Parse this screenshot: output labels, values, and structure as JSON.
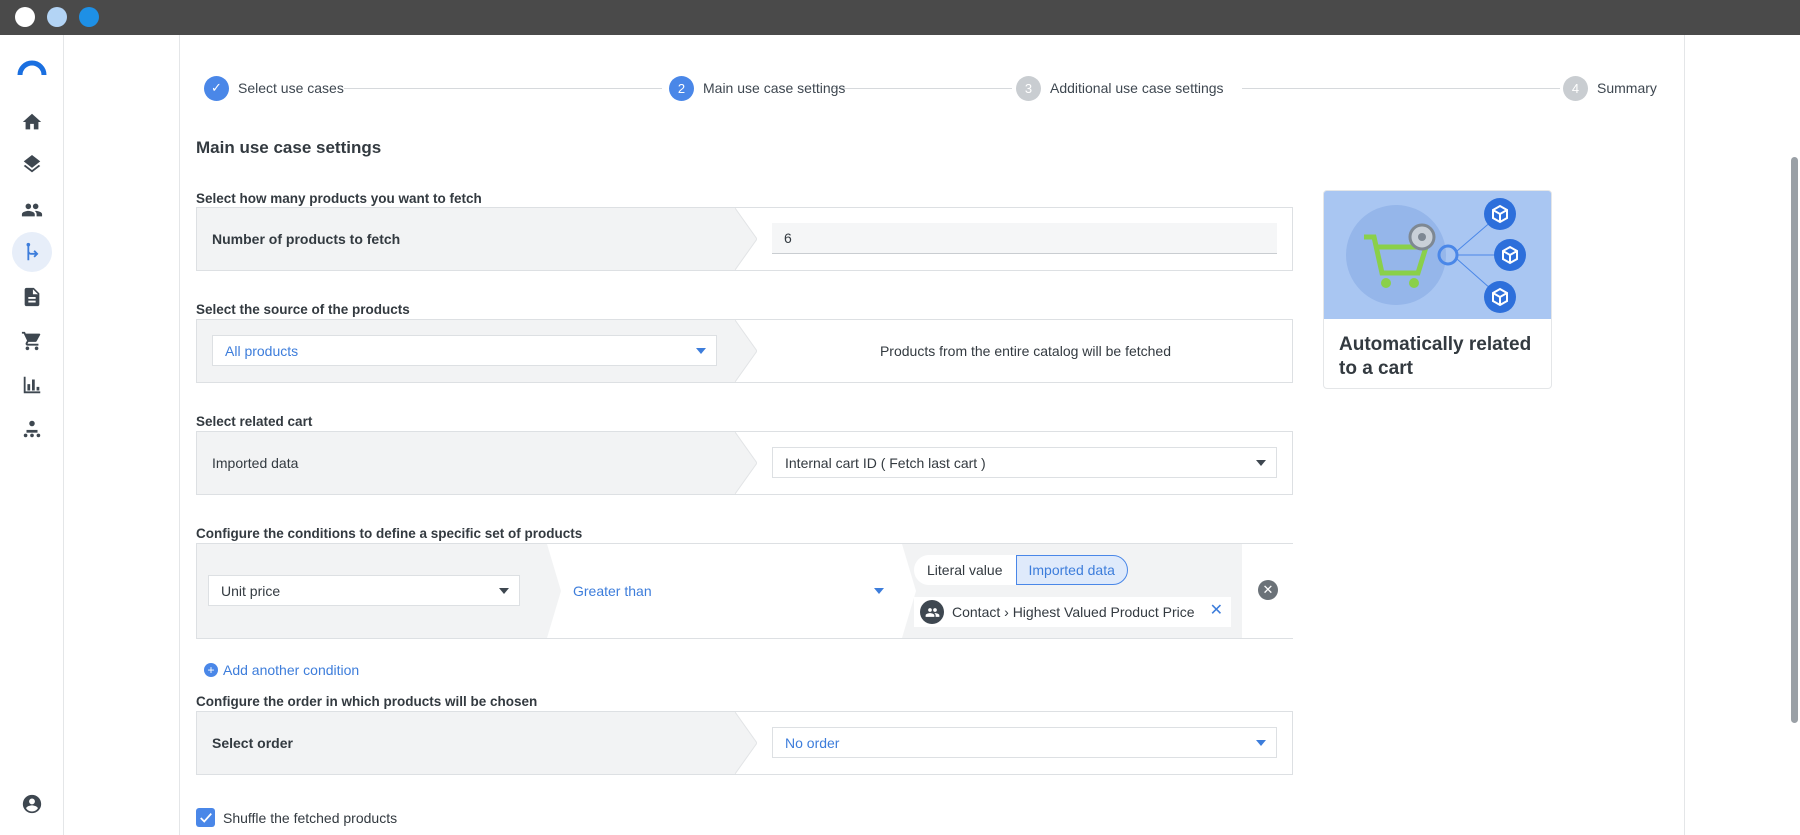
{
  "window": {
    "dots": [
      "#ffffff",
      "#b3d4f5",
      "#1e90e6"
    ]
  },
  "sidebar": {
    "logo": "brand-logo",
    "items": [
      {
        "icon": "home-icon"
      },
      {
        "icon": "layers-icon"
      },
      {
        "icon": "people-icon"
      },
      {
        "icon": "flow-icon",
        "active": true
      },
      {
        "icon": "document-icon"
      },
      {
        "icon": "cart-icon"
      },
      {
        "icon": "bar-chart-icon"
      },
      {
        "icon": "org-icon"
      }
    ],
    "bottom_icon": "account-icon"
  },
  "stepper": {
    "steps": [
      {
        "number": "✓",
        "label": "Select use cases",
        "state": "done"
      },
      {
        "number": "2",
        "label": "Main use case settings",
        "state": "current"
      },
      {
        "number": "3",
        "label": "Additional use case settings",
        "state": "todo"
      },
      {
        "number": "4",
        "label": "Summary",
        "state": "todo"
      }
    ]
  },
  "main": {
    "title": "Main use case settings",
    "fetch_count": {
      "heading": "Select how many products you want to fetch",
      "label": "Number of products to fetch",
      "value": "6"
    },
    "source": {
      "heading": "Select the source of the products",
      "selected": "All products",
      "description": "Products from the entire catalog will be fetched"
    },
    "cart": {
      "heading": "Select related cart",
      "label": "Imported data",
      "selected": "Internal cart ID ( Fetch last cart )"
    },
    "conditions": {
      "heading": "Configure the conditions to define a specific set of products",
      "attribute": "Unit price",
      "operator": "Greater than",
      "toggle_literal": "Literal value",
      "toggle_imported": "Imported data",
      "value_chip": "Contact › Highest Valued Product Price",
      "chip_close": "✕",
      "remove": "✕",
      "add_label": "Add another condition",
      "add_icon": "+"
    },
    "order": {
      "heading": "Configure the order in which products will be chosen",
      "label": "Select order",
      "selected": "No order"
    },
    "shuffle": {
      "label": "Shuffle the fetched products",
      "checked": true
    }
  },
  "side_card": {
    "title": "Automatically related to a cart",
    "illustration": "cart-network-illustration"
  },
  "colors": {
    "accent": "#4a87e8",
    "link": "#3d7ddb",
    "panel": "#f2f3f4",
    "illustration_bg": "#a9c6f2"
  }
}
